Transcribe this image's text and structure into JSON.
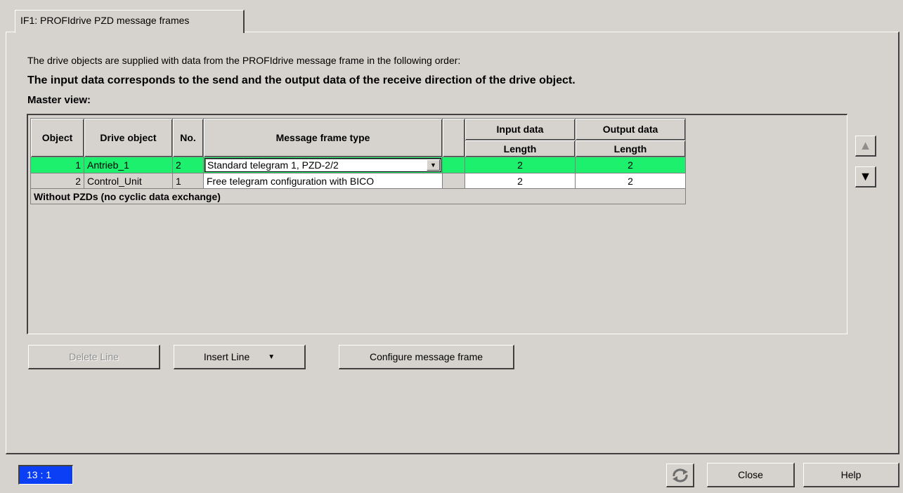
{
  "tab": {
    "label": "IF1:  PROFIdrive  PZD message frames"
  },
  "intro": "The drive objects are supplied with data from the PROFIdrive message frame in the following order:",
  "note": "The input data corresponds to the send and the output data of the receive direction of the drive object.",
  "master_view": "Master view:",
  "grid": {
    "headers": {
      "object": "Object",
      "drive_object": "Drive object",
      "no": "No.",
      "frame_type": "Message frame type",
      "input_data": "Input data",
      "output_data": "Output data",
      "input_length": "Length",
      "output_length": "Length"
    },
    "rows": [
      {
        "object": "1",
        "drive_object": "Antrieb_1",
        "no": "2",
        "frame_type": "Standard telegram 1, PZD-2/2",
        "input_length": "2",
        "output_length": "2"
      },
      {
        "object": "2",
        "drive_object": "Control_Unit",
        "no": "1",
        "frame_type": "Free telegram configuration with BICO",
        "input_length": "2",
        "output_length": "2"
      }
    ],
    "footer": "Without PZDs (no cyclic data exchange)"
  },
  "buttons": {
    "delete_line": "Delete Line",
    "insert_line": "Insert Line",
    "configure": "Configure message frame",
    "close": "Close",
    "help": "Help"
  },
  "status": "13 : 1",
  "colors": {
    "selected_row": "#1cf06d",
    "status_bg": "#0a3ff5",
    "window_bg": "#d6d3ce"
  }
}
